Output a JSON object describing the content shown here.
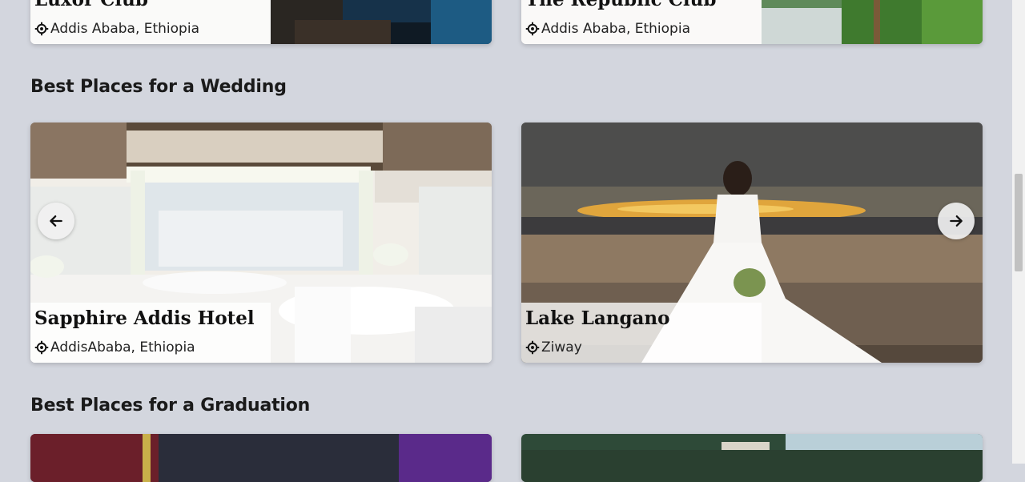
{
  "top_row": {
    "cards": [
      {
        "name": "Luxor Club",
        "location": "Addis Ababa, Ethiopia"
      },
      {
        "name": "The Republic Club",
        "location": "Addis Ababa, Ethiopia"
      }
    ]
  },
  "wedding": {
    "title": "Best Places for a Wedding",
    "cards": [
      {
        "name": "Sapphire Addis Hotel",
        "location": "AddisAbaba, Ethiopia"
      },
      {
        "name": "Lake Langano",
        "location": "Ziway"
      }
    ],
    "prev_icon": "arrow-left-icon",
    "next_icon": "arrow-right-icon"
  },
  "graduation": {
    "title": "Best Places for a Graduation"
  },
  "icons": {
    "location": "location-pin-icon"
  },
  "colors": {
    "page_background": "#d3d6de",
    "caption_background": "#ffffff"
  }
}
